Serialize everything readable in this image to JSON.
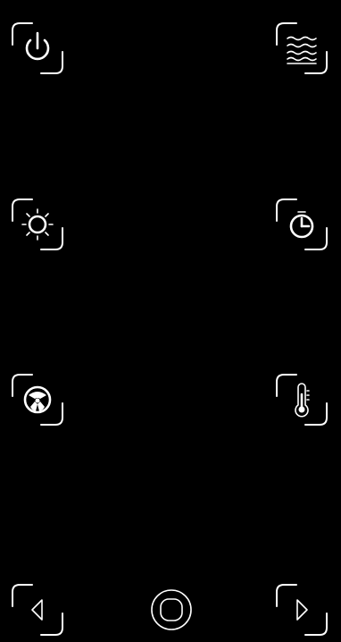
{
  "screen": {
    "background": "#000000",
    "foreground": "#ffffff"
  },
  "controls": {
    "power": {
      "icon": "power-icon"
    },
    "cooking_mode": {
      "icon": "wave-heat-icon"
    },
    "light": {
      "icon": "sun-icon"
    },
    "timer": {
      "icon": "timer-icon"
    },
    "fan": {
      "icon": "fan-icon"
    },
    "temperature": {
      "icon": "thermometer-icon"
    }
  },
  "navigation": {
    "back": {
      "icon": "triangle-left-icon"
    },
    "home": {
      "icon": "home-circle-icon"
    },
    "forward": {
      "icon": "triangle-right-icon"
    }
  }
}
